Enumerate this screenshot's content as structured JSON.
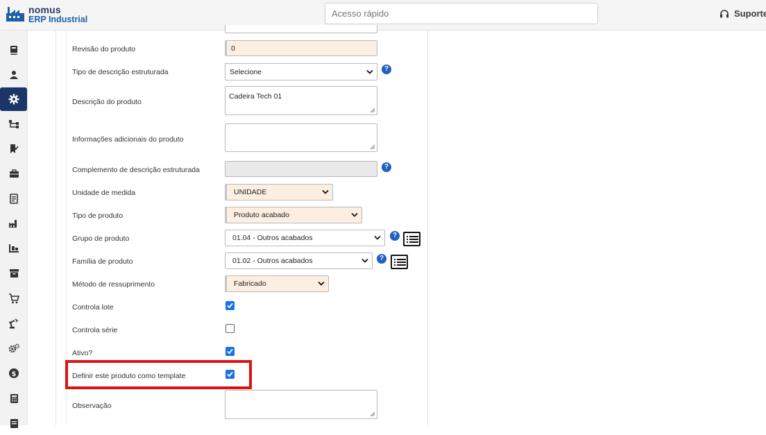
{
  "brand": {
    "line1": "nomus",
    "line2": "ERP Industrial",
    "color": "#1d5fa8"
  },
  "header": {
    "search_placeholder": "Acesso rápido",
    "support_label": "Suporte"
  },
  "sidebar": {
    "active_color": "#1b3569",
    "items": [
      {
        "icon": "book-icon"
      },
      {
        "icon": "user-icon"
      },
      {
        "icon": "gear-icon",
        "active": true
      },
      {
        "icon": "hierarchy-icon"
      },
      {
        "icon": "bookmark-check-icon"
      },
      {
        "icon": "briefcase-icon"
      },
      {
        "icon": "document-icon"
      },
      {
        "icon": "factory-icon"
      },
      {
        "icon": "pallet-icon"
      },
      {
        "icon": "archive-icon"
      },
      {
        "icon": "cart-icon"
      },
      {
        "icon": "robot-arm-icon"
      },
      {
        "icon": "gears-icon"
      },
      {
        "icon": "dollar-icon"
      },
      {
        "icon": "calculator-icon"
      },
      {
        "icon": "report-icon"
      }
    ]
  },
  "form": {
    "revisao": {
      "label": "Revisão do produto",
      "value": "0"
    },
    "tipo_descricao": {
      "label": "Tipo de descrição estruturada",
      "value": "Selecione"
    },
    "descricao": {
      "label": "Descrição do produto",
      "value": "Cadeira Tech 01"
    },
    "info_adicionais": {
      "label": "Informações adicionais do produto",
      "value": ""
    },
    "complemento": {
      "label": "Complemento de descrição estruturada",
      "value": ""
    },
    "unidade": {
      "label": "Unidade de medida",
      "value": "UNIDADE"
    },
    "tipo_produto": {
      "label": "Tipo de produto",
      "value": "Produto acabado"
    },
    "grupo": {
      "label": "Grupo de produto",
      "value": "01.04 - Outros acabados"
    },
    "familia": {
      "label": "Família de produto",
      "value": "01.02 - Outros acabados"
    },
    "metodo": {
      "label": "Método de ressuprimento",
      "value": "Fabricado"
    },
    "controla_lote": {
      "label": "Controla lote",
      "checked": true
    },
    "controla_serie": {
      "label": "Controla série",
      "checked": false
    },
    "ativo": {
      "label": "Ativo?",
      "checked": true
    },
    "template": {
      "label": "Definir este produto como template",
      "checked": true
    },
    "observacao": {
      "label": "Observação",
      "value": ""
    }
  },
  "colors": {
    "highlight": "#e01010",
    "checkbox": "#1a73e8",
    "help": "#1f5fbf",
    "required_field": "#fdeee2"
  }
}
